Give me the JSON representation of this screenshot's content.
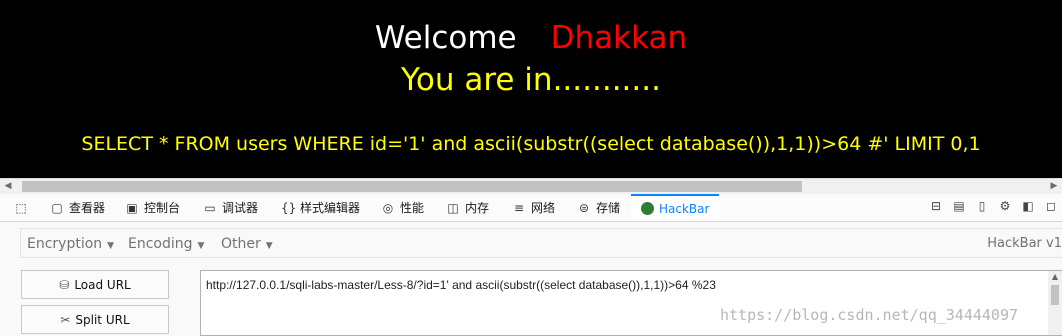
{
  "page": {
    "welcome_word": "Welcome",
    "username": "Dhakkan",
    "status": "You are in...........",
    "query": "SELECT * FROM users WHERE id='1' and ascii(substr((select database()),1,1))>64 #' LIMIT 0,1",
    "colors": {
      "background": "#000000",
      "welcome": "#ffffff",
      "username": "#ff0000",
      "message": "#ffff00"
    }
  },
  "devtools": {
    "tabs": [
      {
        "label": "查看器",
        "icon": "inspector-icon"
      },
      {
        "label": "控制台",
        "icon": "console-icon"
      },
      {
        "label": "调试器",
        "icon": "debugger-icon"
      },
      {
        "label": "样式编辑器",
        "icon": "style-editor-icon"
      },
      {
        "label": "性能",
        "icon": "performance-icon"
      },
      {
        "label": "内存",
        "icon": "memory-icon"
      },
      {
        "label": "网络",
        "icon": "network-icon"
      },
      {
        "label": "存储",
        "icon": "storage-icon"
      },
      {
        "label": "HackBar",
        "icon": "hackbar-icon"
      }
    ],
    "active_tab": "HackBar",
    "accent": "#0a84ff"
  },
  "hackbar": {
    "menus": [
      "Encryption",
      "Encoding",
      "Other"
    ],
    "brand": "HackBar v1",
    "load_url": "Load URL",
    "split_url": "Split URL",
    "url_value": "http://127.0.0.1/sqli-labs-master/Less-8/?id=1' and ascii(substr((select database()),1,1))>64 %23"
  },
  "watermark": "https://blog.csdn.net/qq_34444097"
}
